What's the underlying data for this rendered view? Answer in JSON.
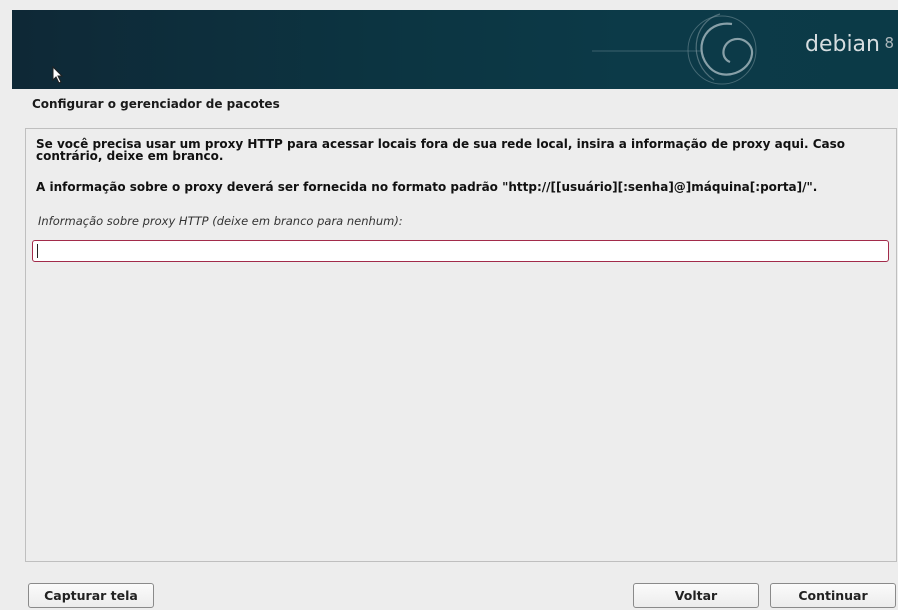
{
  "banner": {
    "brand": "debian",
    "version": "8"
  },
  "page_title": "Configurar o gerenciador de pacotes",
  "description": {
    "line1": "Se você precisa usar um proxy HTTP para acessar locais fora de sua rede local, insira a informação de proxy aqui. Caso contrário, deixe em branco.",
    "line2": "A informação sobre o proxy deverá ser fornecida no formato padrão \"http://[[usuário][:senha]@]máquina[:porta]/\"."
  },
  "proxy_field": {
    "prompt": "Informação sobre proxy HTTP (deixe em branco para nenhum):",
    "value": ""
  },
  "buttons": {
    "screenshot": "Capturar tela",
    "back": "Voltar",
    "continue": "Continuar"
  },
  "colors": {
    "banner_bg": "#0c3542",
    "input_border": "#a22b4a",
    "background": "#ededed"
  }
}
